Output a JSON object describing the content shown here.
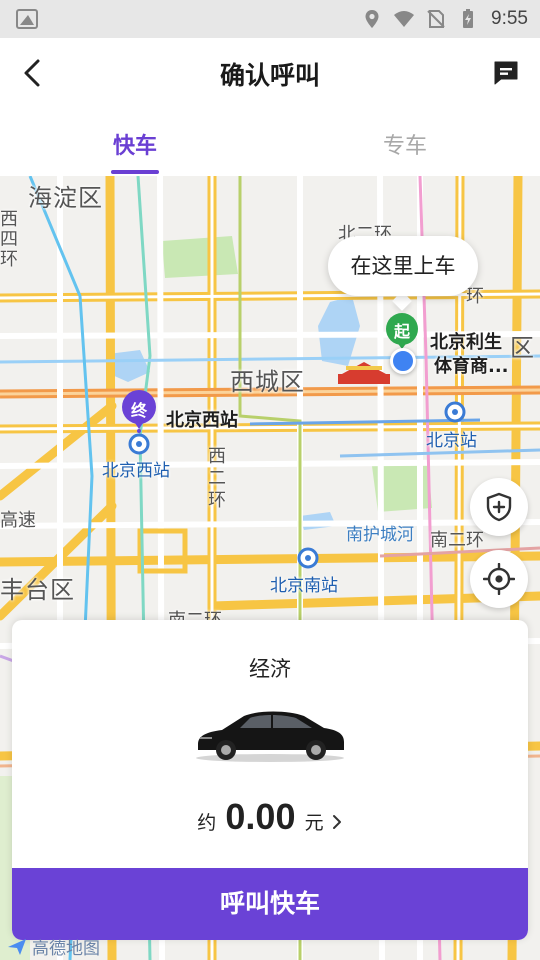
{
  "status_bar": {
    "time": "9:55"
  },
  "header": {
    "title": "确认呼叫"
  },
  "tabs": [
    {
      "label": "快车",
      "active": true
    },
    {
      "label": "专车",
      "active": false
    }
  ],
  "map": {
    "districts": [
      "海淀区",
      "西城区",
      "丰台区",
      "区"
    ],
    "roads": [
      "北二环",
      "环",
      "西二环",
      "南二环",
      "南二环",
      "高速"
    ],
    "pois": [
      "北京西站",
      "北京利生",
      "体育商..."
    ],
    "stations": [
      "北京西站",
      "北京站",
      "北京南站"
    ],
    "rivers": [
      "南护城河"
    ],
    "pickup_bubble": "在这里上车",
    "start_marker": "起",
    "end_marker": "终",
    "provider": "高德地图",
    "left_partial": [
      "西",
      "四",
      "环"
    ]
  },
  "ride_card": {
    "car_type": "经济",
    "price_prefix": "约",
    "price": "0.00",
    "price_unit": "元",
    "call_button": "呼叫快车"
  },
  "colors": {
    "accent": "#6a42d6",
    "tab_active": "#6a3fd3",
    "start_green": "#2fa84f",
    "end_purple": "#6a42d6",
    "location_blue": "#3f83f2"
  }
}
